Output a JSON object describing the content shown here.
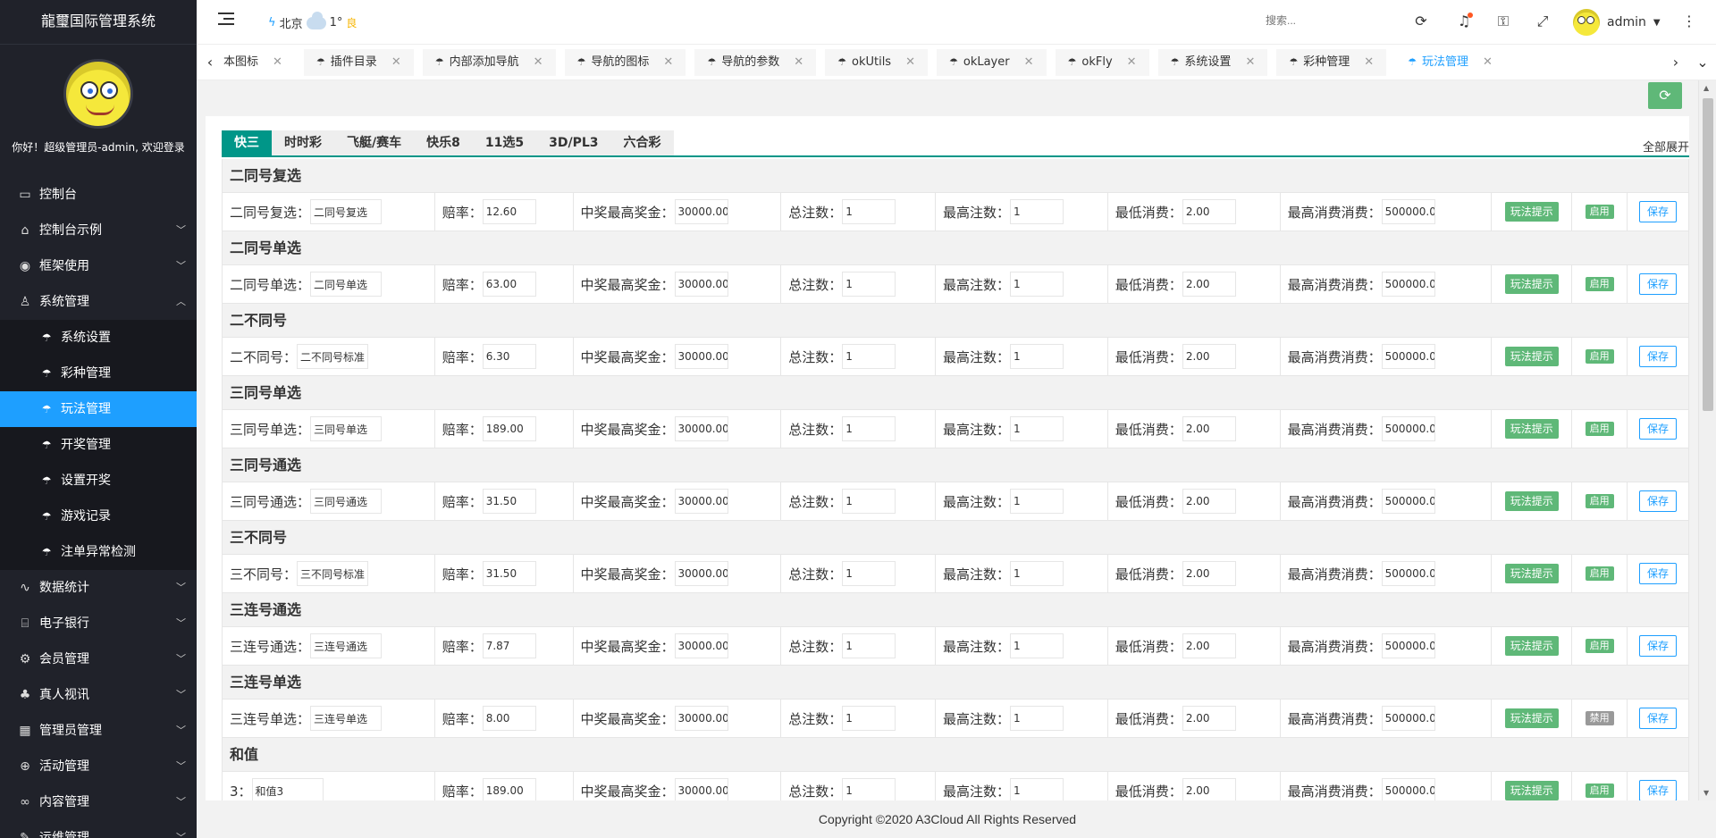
{
  "app": {
    "title": "龍璽国际管理系统",
    "greeting": "你好！超级管理员-admin, 欢迎登录"
  },
  "sidebar": {
    "items": [
      {
        "label": "控制台",
        "icon": "dashboard-icon",
        "glyph": "▭"
      },
      {
        "label": "控制台示例",
        "icon": "home-icon",
        "glyph": "⌂",
        "arrow": "▾"
      },
      {
        "label": "框架使用",
        "icon": "framework-icon",
        "glyph": "◉",
        "arrow": "▾"
      },
      {
        "label": "系统管理",
        "icon": "user-icon",
        "glyph": "♙",
        "arrow": "▴"
      }
    ],
    "sub_items": [
      {
        "label": "系统设置",
        "icon": "umbrella-icon"
      },
      {
        "label": "彩种管理",
        "icon": "umbrella-icon"
      },
      {
        "label": "玩法管理",
        "icon": "umbrella-icon",
        "active": true
      },
      {
        "label": "开奖管理",
        "icon": "umbrella-icon"
      },
      {
        "label": "设置开奖",
        "icon": "umbrella-icon"
      },
      {
        "label": "游戏记录",
        "icon": "umbrella-icon"
      },
      {
        "label": "注单异常检测",
        "icon": "umbrella-icon"
      }
    ],
    "items_after": [
      {
        "label": "数据统计",
        "icon": "chart-icon",
        "glyph": "∿",
        "arrow": "▾"
      },
      {
        "label": "电子银行",
        "icon": "bank-icon",
        "glyph": "⌸",
        "arrow": "▾"
      },
      {
        "label": "会员管理",
        "icon": "gear-icon",
        "glyph": "⚙",
        "arrow": "▾"
      },
      {
        "label": "真人视讯",
        "icon": "people-icon",
        "glyph": "♣",
        "arrow": "▾"
      },
      {
        "label": "管理员管理",
        "icon": "grid-icon",
        "glyph": "▦",
        "arrow": "▾"
      },
      {
        "label": "活动管理",
        "icon": "plus-circle-icon",
        "glyph": "⊕",
        "arrow": "▾"
      },
      {
        "label": "内容管理",
        "icon": "infinity-icon",
        "glyph": "∞",
        "arrow": "▾"
      },
      {
        "label": "运维管理",
        "icon": "wrench-icon",
        "glyph": "✎",
        "arrow": "▾"
      }
    ]
  },
  "header": {
    "city": "北京",
    "temp": "1°",
    "air_quality": "良",
    "search_placeholder": "搜索...",
    "username": "admin"
  },
  "tabs": [
    {
      "label": "本图标",
      "first": true
    },
    {
      "label": "插件目录"
    },
    {
      "label": "内部添加导航"
    },
    {
      "label": "导航的图标"
    },
    {
      "label": "导航的参数"
    },
    {
      "label": "okUtils"
    },
    {
      "label": "okLayer"
    },
    {
      "label": "okFly"
    },
    {
      "label": "系统设置"
    },
    {
      "label": "彩种管理"
    },
    {
      "label": "玩法管理",
      "active": true
    }
  ],
  "game_tabs": [
    {
      "label": "快三",
      "active": true
    },
    {
      "label": "时时彩"
    },
    {
      "label": "飞艇/赛车"
    },
    {
      "label": "快乐8"
    },
    {
      "label": "11选5"
    },
    {
      "label": "3D/PL3"
    },
    {
      "label": "六合彩"
    }
  ],
  "expand_all": "全部展开",
  "labels": {
    "odds": "赔率：",
    "max_prize": "中奖最高奖金：",
    "total_bets": "总注数：",
    "max_bets": "最高注数：",
    "min_spend": "最低消费：",
    "max_spend": "最高消费消费：",
    "tip_btn": "玩法提示",
    "save_btn": "保存"
  },
  "sections": [
    {
      "title": "二同号复选",
      "row_label": "二同号复选：",
      "name": "二同号复选",
      "odds": "12.60",
      "max_prize": "30000.00",
      "total": "1",
      "max_bets": "1",
      "min": "2.00",
      "max": "500000.0",
      "status": "启用",
      "enabled": true
    },
    {
      "title": "二同号单选",
      "row_label": "二同号单选：",
      "name": "二同号单选",
      "odds": "63.00",
      "max_prize": "30000.00",
      "total": "1",
      "max_bets": "1",
      "min": "2.00",
      "max": "500000.0",
      "status": "启用",
      "enabled": true
    },
    {
      "title": "二不同号",
      "row_label": "二不同号：",
      "name": "二不同号标准",
      "odds": "6.30",
      "max_prize": "30000.00",
      "total": "1",
      "max_bets": "1",
      "min": "2.00",
      "max": "500000.0",
      "status": "启用",
      "enabled": true
    },
    {
      "title": "三同号单选",
      "row_label": "三同号单选：",
      "name": "三同号单选",
      "odds": "189.00",
      "max_prize": "30000.00",
      "total": "1",
      "max_bets": "1",
      "min": "2.00",
      "max": "500000.0",
      "status": "启用",
      "enabled": true
    },
    {
      "title": "三同号通选",
      "row_label": "三同号通选：",
      "name": "三同号通选",
      "odds": "31.50",
      "max_prize": "30000.00",
      "total": "1",
      "max_bets": "1",
      "min": "2.00",
      "max": "500000.0",
      "status": "启用",
      "enabled": true
    },
    {
      "title": "三不同号",
      "row_label": "三不同号：",
      "name": "三不同号标准",
      "odds": "31.50",
      "max_prize": "30000.00",
      "total": "1",
      "max_bets": "1",
      "min": "2.00",
      "max": "500000.0",
      "status": "启用",
      "enabled": true
    },
    {
      "title": "三连号通选",
      "row_label": "三连号通选：",
      "name": "三连号通选",
      "odds": "7.87",
      "max_prize": "30000.00",
      "total": "1",
      "max_bets": "1",
      "min": "2.00",
      "max": "500000.0",
      "status": "启用",
      "enabled": true
    },
    {
      "title": "三连号单选",
      "row_label": "三连号单选：",
      "name": "三连号单选",
      "odds": "8.00",
      "max_prize": "30000.00",
      "total": "1",
      "max_bets": "1",
      "min": "2.00",
      "max": "500000.0",
      "status": "禁用",
      "enabled": false
    },
    {
      "title": "和值",
      "row_label": "3：",
      "name": "和值3",
      "odds": "189.00",
      "max_prize": "30000.00",
      "total": "1",
      "max_bets": "1",
      "min": "2.00",
      "max": "500000.0",
      "status": "启用",
      "enabled": true
    }
  ],
  "footer": "Copyright ©2020 A3Cloud All Rights Reserved"
}
